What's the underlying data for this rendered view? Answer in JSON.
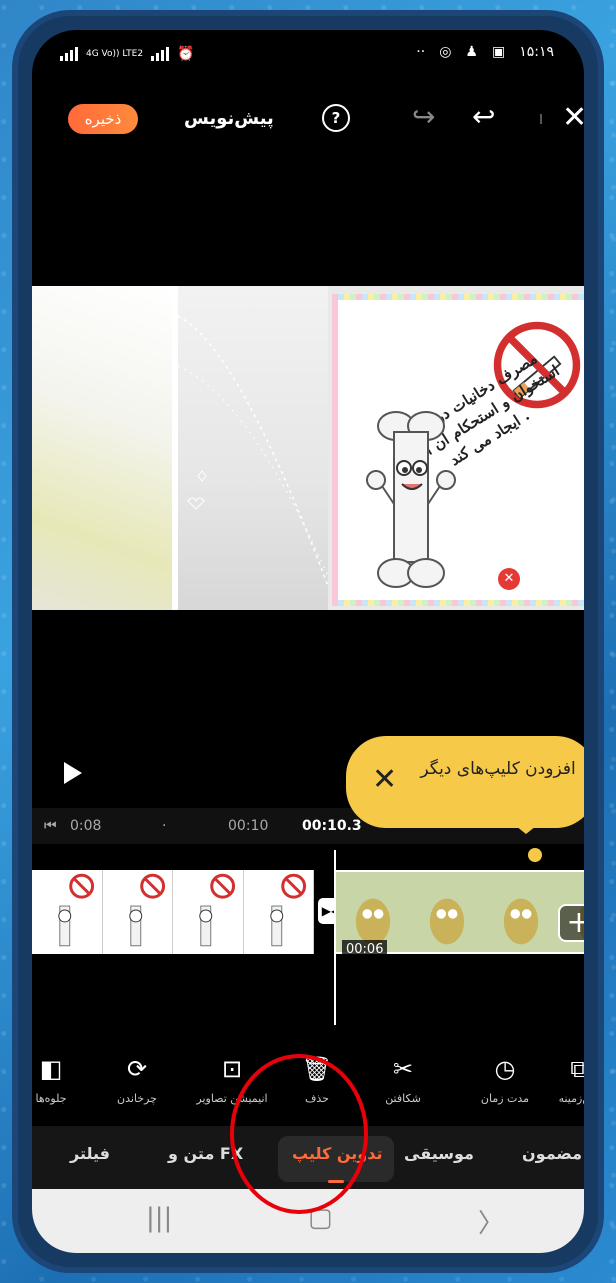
{
  "status_bar": {
    "left_text": "4G Vo)) LTE2",
    "time": "۱۵:۱۹"
  },
  "app_bar": {
    "save_label": "ذخیره",
    "title": "پیش‌نویس",
    "help_label": "?"
  },
  "preview": {
    "poster_text": "مصرف دخانیات در ساخت استخوان و استحکام آن اختلال ایجاد می کند ."
  },
  "player": {
    "time_start": "0:08",
    "time_mid": "00:10",
    "time_current": "00:10.3"
  },
  "tooltip": {
    "text": "افزودن کلیپ‌های دیگر",
    "close": "✕"
  },
  "timeline": {
    "clip_duration": "00:06"
  },
  "tools": [
    {
      "label": "پس‌زمینه",
      "icon": "background-icon"
    },
    {
      "label": "مدت زمان",
      "icon": "duration-icon"
    },
    {
      "label": "شکافتن",
      "icon": "scissors-icon"
    },
    {
      "label": "حذف",
      "icon": "trash-icon"
    },
    {
      "label": "انیمیشن تصاویر",
      "icon": "image-animation-icon"
    },
    {
      "label": "چرخاندن",
      "icon": "rotate-icon"
    },
    {
      "label": "جلوه‌ها",
      "icon": "effects-icon"
    }
  ],
  "tabs": [
    {
      "label": "مضمون"
    },
    {
      "label": "موسیقی"
    },
    {
      "label": "تدوین کلیپ",
      "active": true
    },
    {
      "label": "متن و FX"
    },
    {
      "label": "فیلتر"
    }
  ],
  "colors": {
    "accent": "#ff6a3a",
    "tooltip": "#f7c948",
    "annotation": "#e8000b"
  }
}
